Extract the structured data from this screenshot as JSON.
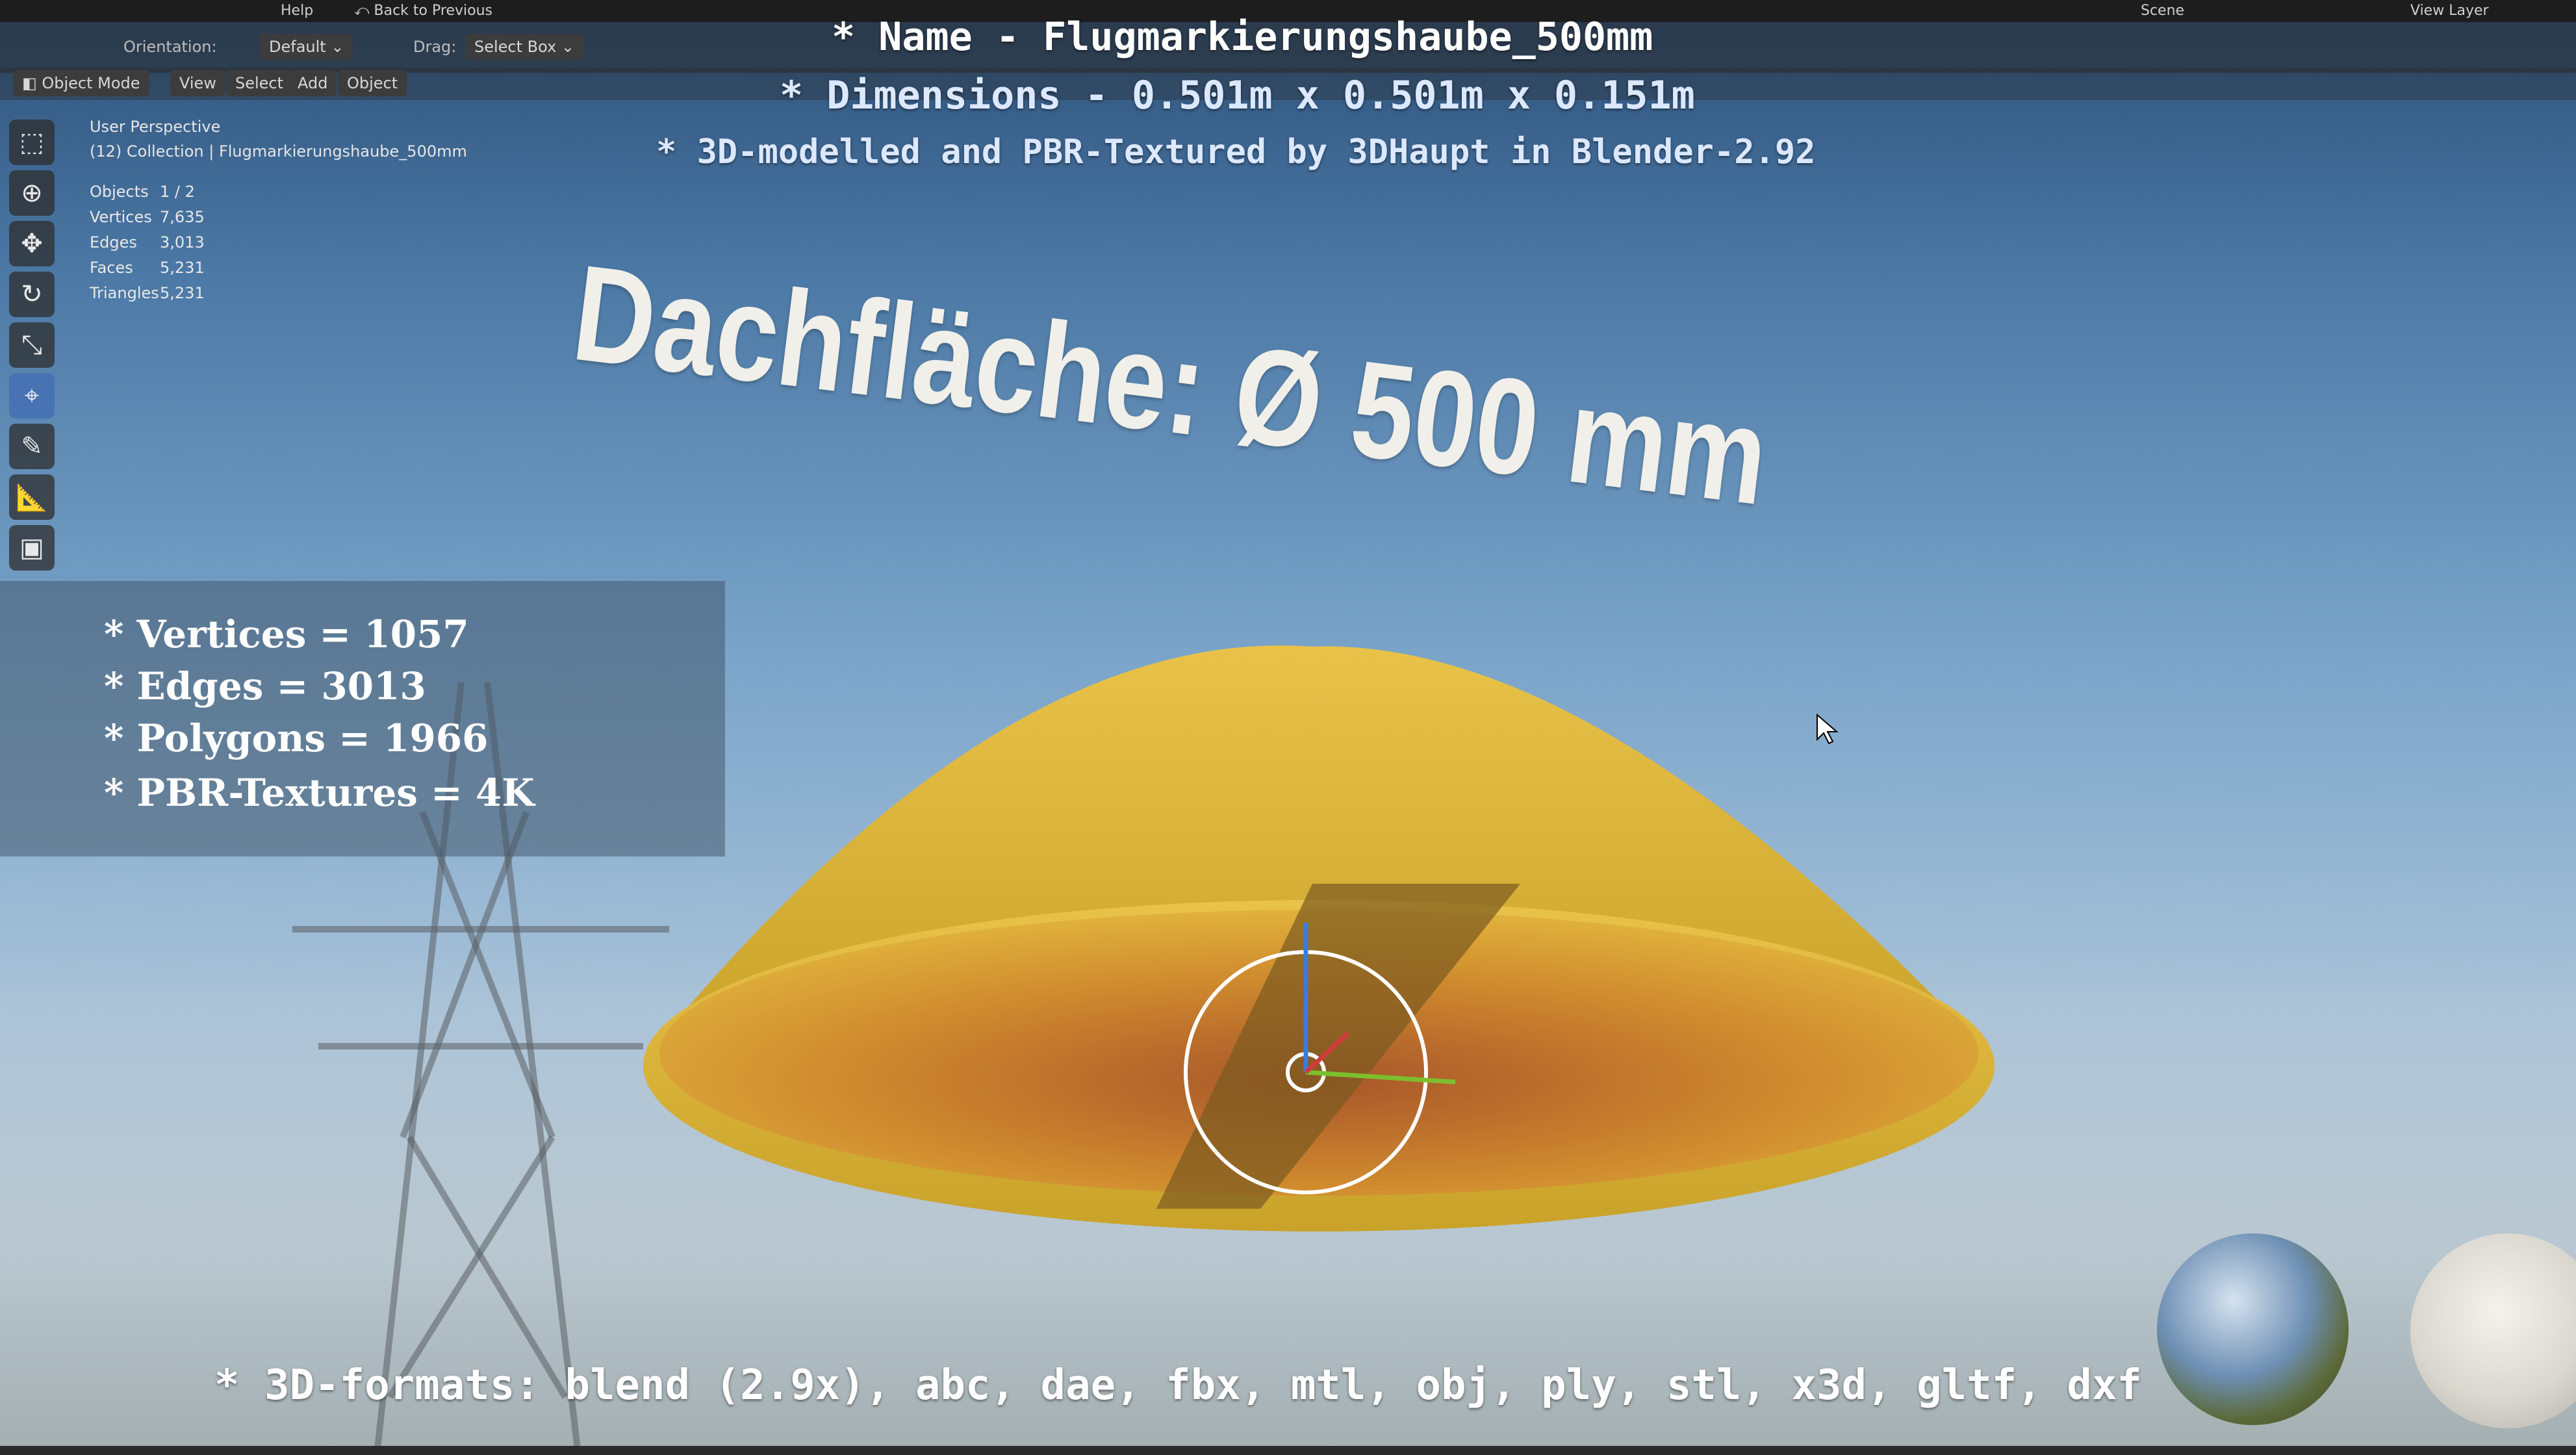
{
  "menubar": {
    "help": "Help",
    "back": "Back to Previous",
    "scene": "Scene",
    "view_layer": "View Layer"
  },
  "header": {
    "orientation_label": "Orientation:",
    "orientation_value": "Default",
    "drag_label": "Drag:",
    "drag_value": "Select Box"
  },
  "viewport_header": {
    "mode": "Object Mode",
    "menus": [
      "View",
      "Select",
      "Add",
      "Object"
    ]
  },
  "viewport": {
    "perspective": "User Perspective",
    "collection": "(12) Collection | Flugmarkierungshaube_500mm"
  },
  "stats": [
    {
      "label": "Objects",
      "value": "1 / 2"
    },
    {
      "label": "Vertices",
      "value": "7,635"
    },
    {
      "label": "Edges",
      "value": "3,013"
    },
    {
      "label": "Faces",
      "value": "5,231"
    },
    {
      "label": "Triangles",
      "value": "5,231"
    }
  ],
  "overlay": {
    "name": "* Name - Flugmarkierungshaube_500mm",
    "dimensions": "* Dimensions -  0.501m x 0.501m x 0.151m",
    "credits": "* 3D-modelled and PBR-Textured by 3DHaupt in Blender-2.92",
    "info": [
      "* Vertices = 1057",
      "* Edges = 3013",
      "* Polygons = 1966",
      "* PBR-Textures = 4K"
    ],
    "dach": "Dachfläche:  Ø 500 mm",
    "formats": "* 3D-formats: blend (2.9x), abc, dae, fbx, mtl, obj, ply, stl, x3d, gltf, dxf"
  },
  "colors": {
    "cone": "#e5b83a",
    "cone_inner": "#c9852c",
    "active_tool": "#4772b3"
  },
  "icons": [
    "select-box-icon",
    "cursor-icon",
    "move-icon",
    "rotate-icon",
    "scale-icon",
    "transform-icon",
    "annotate-icon",
    "measure-icon",
    "add-cube-icon"
  ]
}
